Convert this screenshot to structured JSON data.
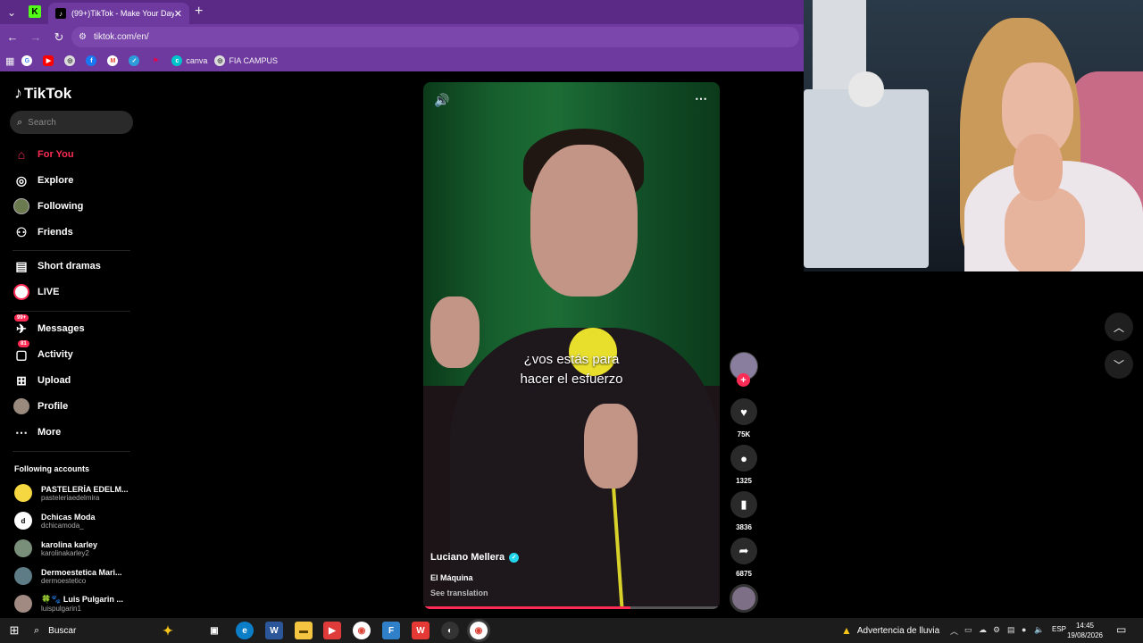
{
  "browser": {
    "tab_title": "(99+)TikTok - Make Your Day",
    "url": "tiktok.com/en/",
    "bookmarks": [
      "canva",
      "FIA CAMPUS"
    ]
  },
  "sidebar": {
    "logo": "TikTok",
    "search_placeholder": "Search",
    "items": [
      {
        "label": "For You"
      },
      {
        "label": "Explore"
      },
      {
        "label": "Following"
      },
      {
        "label": "Friends"
      },
      {
        "label": "Short dramas"
      },
      {
        "label": "LIVE"
      },
      {
        "label": "Messages",
        "badge": "99+"
      },
      {
        "label": "Activity",
        "badge": "81"
      },
      {
        "label": "Upload"
      },
      {
        "label": "Profile"
      },
      {
        "label": "More"
      }
    ],
    "following_title": "Following accounts",
    "accounts": [
      {
        "name": "PASTELERÍA EDELM...",
        "handle": "pasteleriaedelmira"
      },
      {
        "name": "Dchicas Moda",
        "handle": "dchicamoda_"
      },
      {
        "name": "karolina karley",
        "handle": "karolinakarley2"
      },
      {
        "name": "Dermoestetica Mari...",
        "handle": "dermoestetico"
      },
      {
        "name": "🍀🐾 Luis Pulgarin ...",
        "handle": "luispulgarin1"
      }
    ]
  },
  "video": {
    "caption_line1": "¿vos estás para",
    "caption_line2": "hacer el esfuerzo",
    "author": "Luciano Mellera",
    "description": "El Máquina",
    "see_translation": "See translation",
    "progress": 0.7
  },
  "actions": {
    "likes": "75K",
    "comments": "1325",
    "saves": "3836",
    "shares": "6875"
  },
  "taskbar": {
    "search": "Buscar",
    "weather": "Advertencia de lluvia",
    "lang": "ESP",
    "time": "14:45",
    "date": "19/08/2026"
  },
  "colors": {
    "accent": "#fe2c55",
    "browser_chrome": "#6f3aa0"
  }
}
